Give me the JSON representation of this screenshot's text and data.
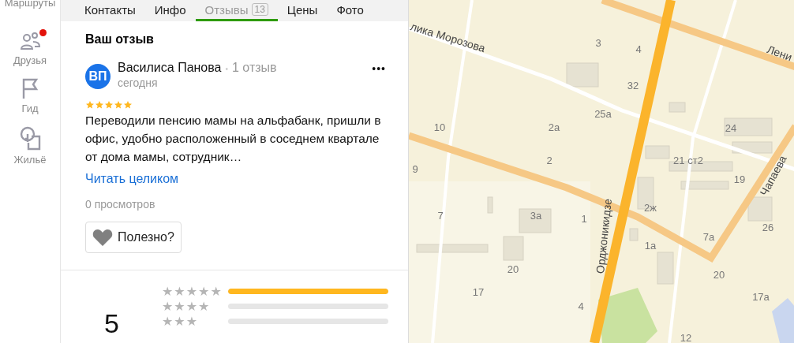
{
  "sidebar": {
    "items": [
      {
        "label": "Маршруты",
        "kind": "route",
        "notification": false
      },
      {
        "label": "Друзья",
        "kind": "friends",
        "notification": true
      },
      {
        "label": "Гид",
        "kind": "guide",
        "notification": false
      },
      {
        "label": "Жильё",
        "kind": "housing",
        "notification": false
      }
    ]
  },
  "tabs": [
    {
      "label": "Контакты",
      "selected": false
    },
    {
      "label": "Инфо",
      "selected": false
    },
    {
      "label": "Отзывы",
      "badge": "13",
      "selected": true
    },
    {
      "label": "Цены",
      "selected": false
    },
    {
      "label": "Фото",
      "selected": false
    }
  ],
  "my_review": {
    "title": "Ваш отзыв",
    "avatar": "ВП",
    "author": "Василиса Панова",
    "separator": "•",
    "author_reviews": "1 отзыв",
    "date": "сегодня",
    "menu": "•••",
    "stars": 5,
    "text": "Переводили пенсию мамы на альфабанк, пришли в офис, удобно расположенный в соседнем квартале от дома мамы, сотрудник…",
    "read_more": "Читать целиком",
    "views": "0 просмотров",
    "helpful_button": "Полезно?"
  },
  "rating": {
    "value": "5",
    "distribution": [
      {
        "label": "★★★★★",
        "level": 1
      },
      {
        "label": "★★★★",
        "level": 0
      },
      {
        "label": "★★★",
        "level": 0
      }
    ]
  },
  "map": {
    "labels": [
      {
        "text": "лика Морозова",
        "kind": "street"
      },
      {
        "text": "3",
        "kind": "house"
      },
      {
        "text": "4",
        "kind": "house"
      },
      {
        "text": "Лени",
        "kind": "street"
      },
      {
        "text": "32",
        "kind": "house"
      },
      {
        "text": "25а",
        "kind": "house"
      },
      {
        "text": "10",
        "kind": "house"
      },
      {
        "text": "2а",
        "kind": "house"
      },
      {
        "text": "24",
        "kind": "house"
      },
      {
        "text": "9",
        "kind": "house"
      },
      {
        "text": "2",
        "kind": "house"
      },
      {
        "text": "21 ст2",
        "kind": "house"
      },
      {
        "text": "19",
        "kind": "house"
      },
      {
        "text": "Чапаева",
        "kind": "street"
      },
      {
        "text": "2ж",
        "kind": "house"
      },
      {
        "text": "7",
        "kind": "house"
      },
      {
        "text": "3а",
        "kind": "house"
      },
      {
        "text": "1",
        "kind": "house"
      },
      {
        "text": "26",
        "kind": "house"
      },
      {
        "text": "Орджоникидзе",
        "kind": "street"
      },
      {
        "text": "7а",
        "kind": "house"
      },
      {
        "text": "1а",
        "kind": "house"
      },
      {
        "text": "20",
        "kind": "house"
      },
      {
        "text": "20",
        "kind": "house"
      },
      {
        "text": "17",
        "kind": "house"
      },
      {
        "text": "17а",
        "kind": "house"
      },
      {
        "text": "4",
        "kind": "house"
      },
      {
        "text": "12",
        "kind": "house"
      }
    ]
  }
}
